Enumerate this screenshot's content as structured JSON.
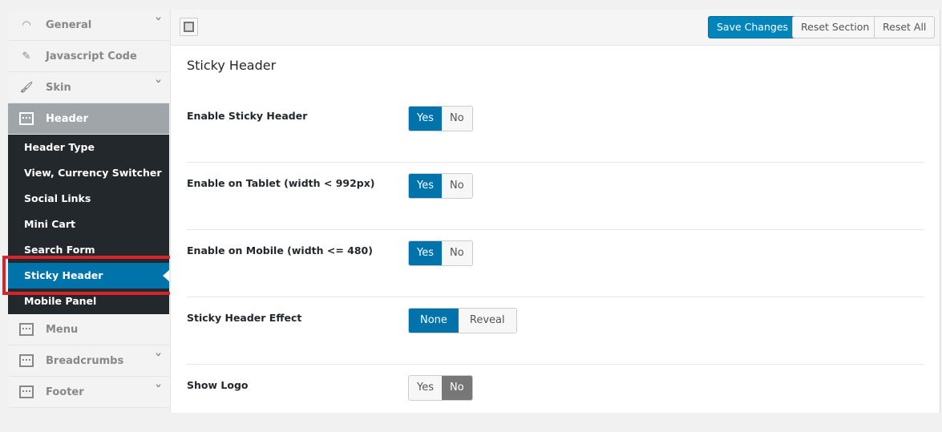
{
  "sidebar": {
    "items": [
      {
        "label": "General",
        "icon": "dashboard-icon",
        "chevron": true
      },
      {
        "label": "Javascript Code",
        "icon": "edit-icon",
        "chevron": false
      },
      {
        "label": "Skin",
        "icon": "brush-icon",
        "chevron": true
      },
      {
        "label": "Header",
        "icon": "layout-icon",
        "chevron": false,
        "active": true
      }
    ],
    "sub": [
      "Header Type",
      "View, Currency Switcher",
      "Social Links",
      "Mini Cart",
      "Search Form",
      "Sticky Header",
      "Mobile Panel"
    ],
    "bottom": [
      {
        "label": "Menu",
        "chevron": false
      },
      {
        "label": "Breadcrumbs",
        "chevron": true
      },
      {
        "label": "Footer",
        "chevron": true
      }
    ]
  },
  "toolbar": {
    "save": "Save Changes",
    "reset_section": "Reset Section",
    "reset_all": "Reset All"
  },
  "main": {
    "title": "Sticky Header",
    "rows": [
      {
        "label": "Enable Sticky Header",
        "options": [
          "Yes",
          "No"
        ],
        "selected": "Yes"
      },
      {
        "label": "Enable on Tablet (width < 992px)",
        "options": [
          "Yes",
          "No"
        ],
        "selected": "Yes"
      },
      {
        "label": "Enable on Mobile (width <= 480)",
        "options": [
          "Yes",
          "No"
        ],
        "selected": "Yes"
      },
      {
        "label": "Sticky Header Effect",
        "options": [
          "None",
          "Reveal"
        ],
        "selected": "None"
      },
      {
        "label": "Show Logo",
        "options": [
          "Yes",
          "No"
        ],
        "selected": "No"
      }
    ]
  },
  "colors": {
    "accent": "#0073aa",
    "highlight": "#d9232d",
    "submenu": "#23282d"
  }
}
